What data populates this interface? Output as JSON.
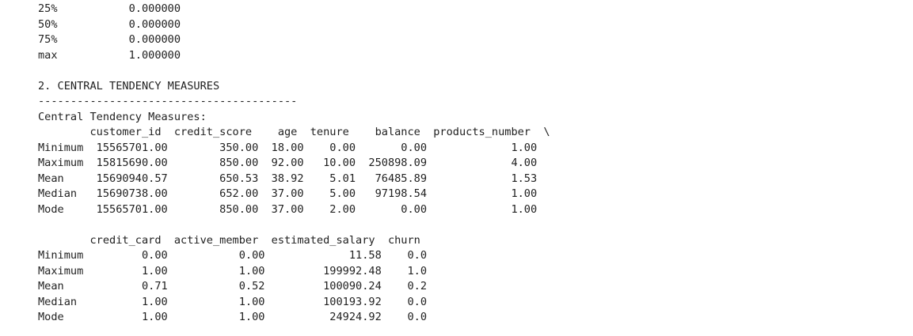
{
  "output": {
    "lines": [
      "25%           0.000000",
      "50%           0.000000",
      "75%           0.000000",
      "max           1.000000",
      "",
      "2. CENTRAL TENDENCY MEASURES",
      "----------------------------------------",
      "Central Tendency Measures:",
      "        customer_id  credit_score    age  tenure    balance  products_number  \\",
      "Minimum  15565701.00        350.00  18.00    0.00       0.00             1.00",
      "Maximum  15815690.00        850.00  92.00   10.00  250898.09             4.00",
      "Mean     15690940.57        650.53  38.92    5.01   76485.89             1.53",
      "Median   15690738.00        652.00  37.00    5.00   97198.54             1.00",
      "Mode     15565701.00        850.00  37.00    2.00       0.00             1.00",
      "",
      "        credit_card  active_member  estimated_salary  churn",
      "Minimum         0.00           0.00             11.58    0.0",
      "Maximum         1.00           1.00         199992.48    1.0",
      "Mean            0.71           0.52         100090.24    0.2",
      "Median          1.00           1.00         100193.92    0.0",
      "Mode            1.00           1.00          24924.92    0.0"
    ]
  }
}
